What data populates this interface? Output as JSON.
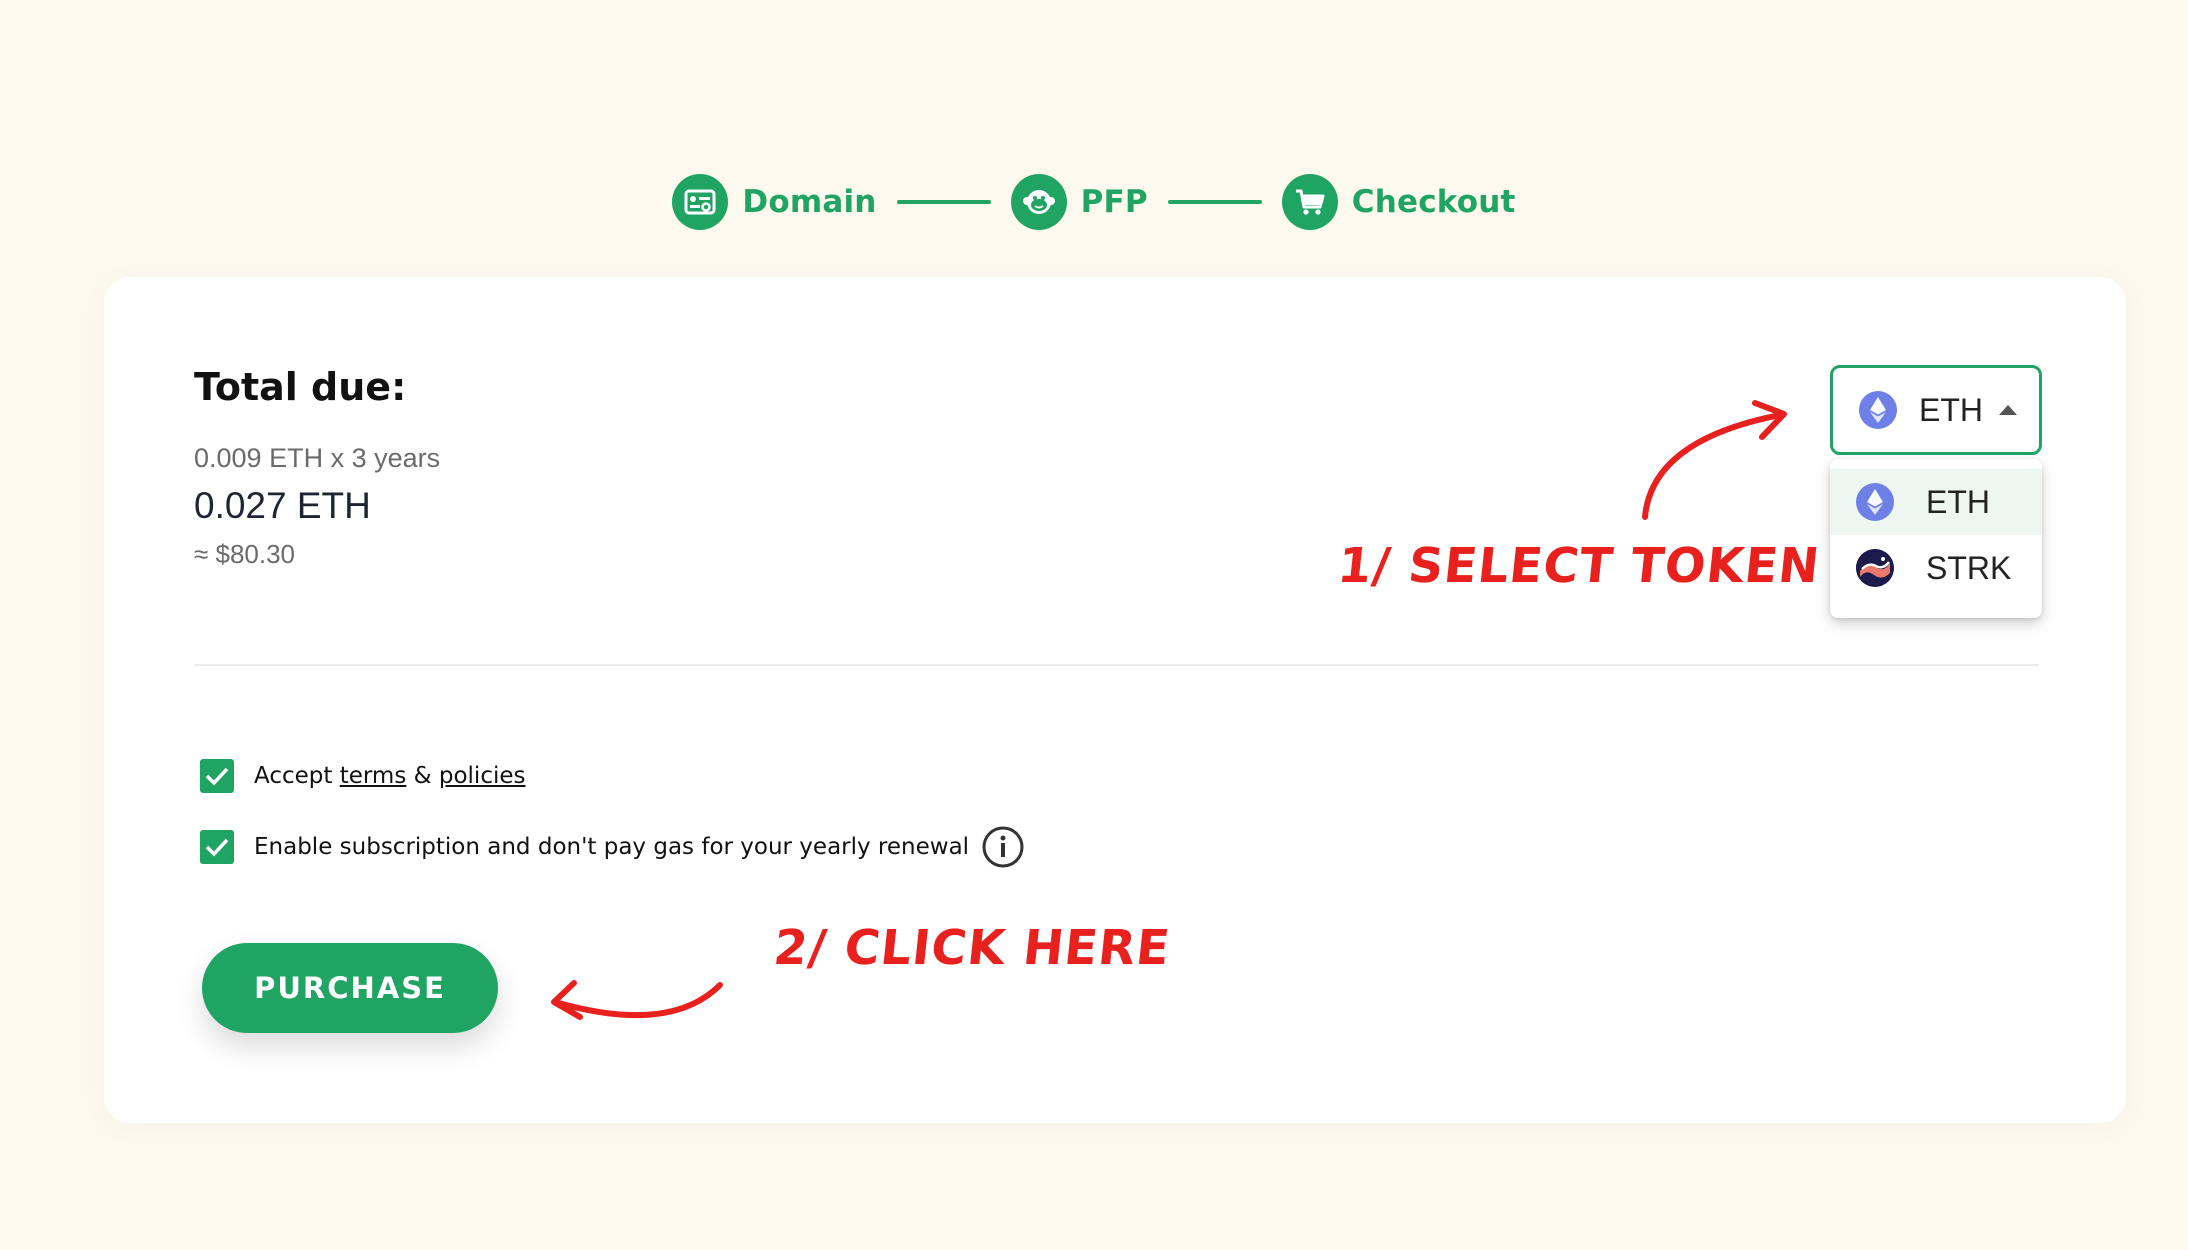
{
  "stepper": {
    "steps": [
      {
        "label": "Domain",
        "icon": "domain-card-icon"
      },
      {
        "label": "PFP",
        "icon": "monkey-face-icon"
      },
      {
        "label": "Checkout",
        "icon": "cart-icon"
      }
    ]
  },
  "checkout": {
    "title": "Total due:",
    "price_detail": "0.009 ETH x 3 years",
    "price_total": "0.027 ETH",
    "price_usd": "≈ $80.30"
  },
  "token_select": {
    "selected": "ETH",
    "options": [
      {
        "label": "ETH",
        "icon": "eth-icon"
      },
      {
        "label": "STRK",
        "icon": "strk-icon"
      }
    ]
  },
  "agreements": {
    "accept_prefix": "Accept",
    "terms_link": "terms",
    "ampersand": "&",
    "policies_link": "policies",
    "subscription_label": "Enable subscription and don't pay gas for your yearly renewal"
  },
  "purchase": {
    "label": "PURCHASE"
  },
  "annotations": {
    "select_token": "1/ SELECT TOKEN",
    "click_here": "2/ CLICK HERE"
  },
  "colors": {
    "accent": "#1fa463",
    "background": "#fdf9ee",
    "annotation": "#e8201e"
  }
}
